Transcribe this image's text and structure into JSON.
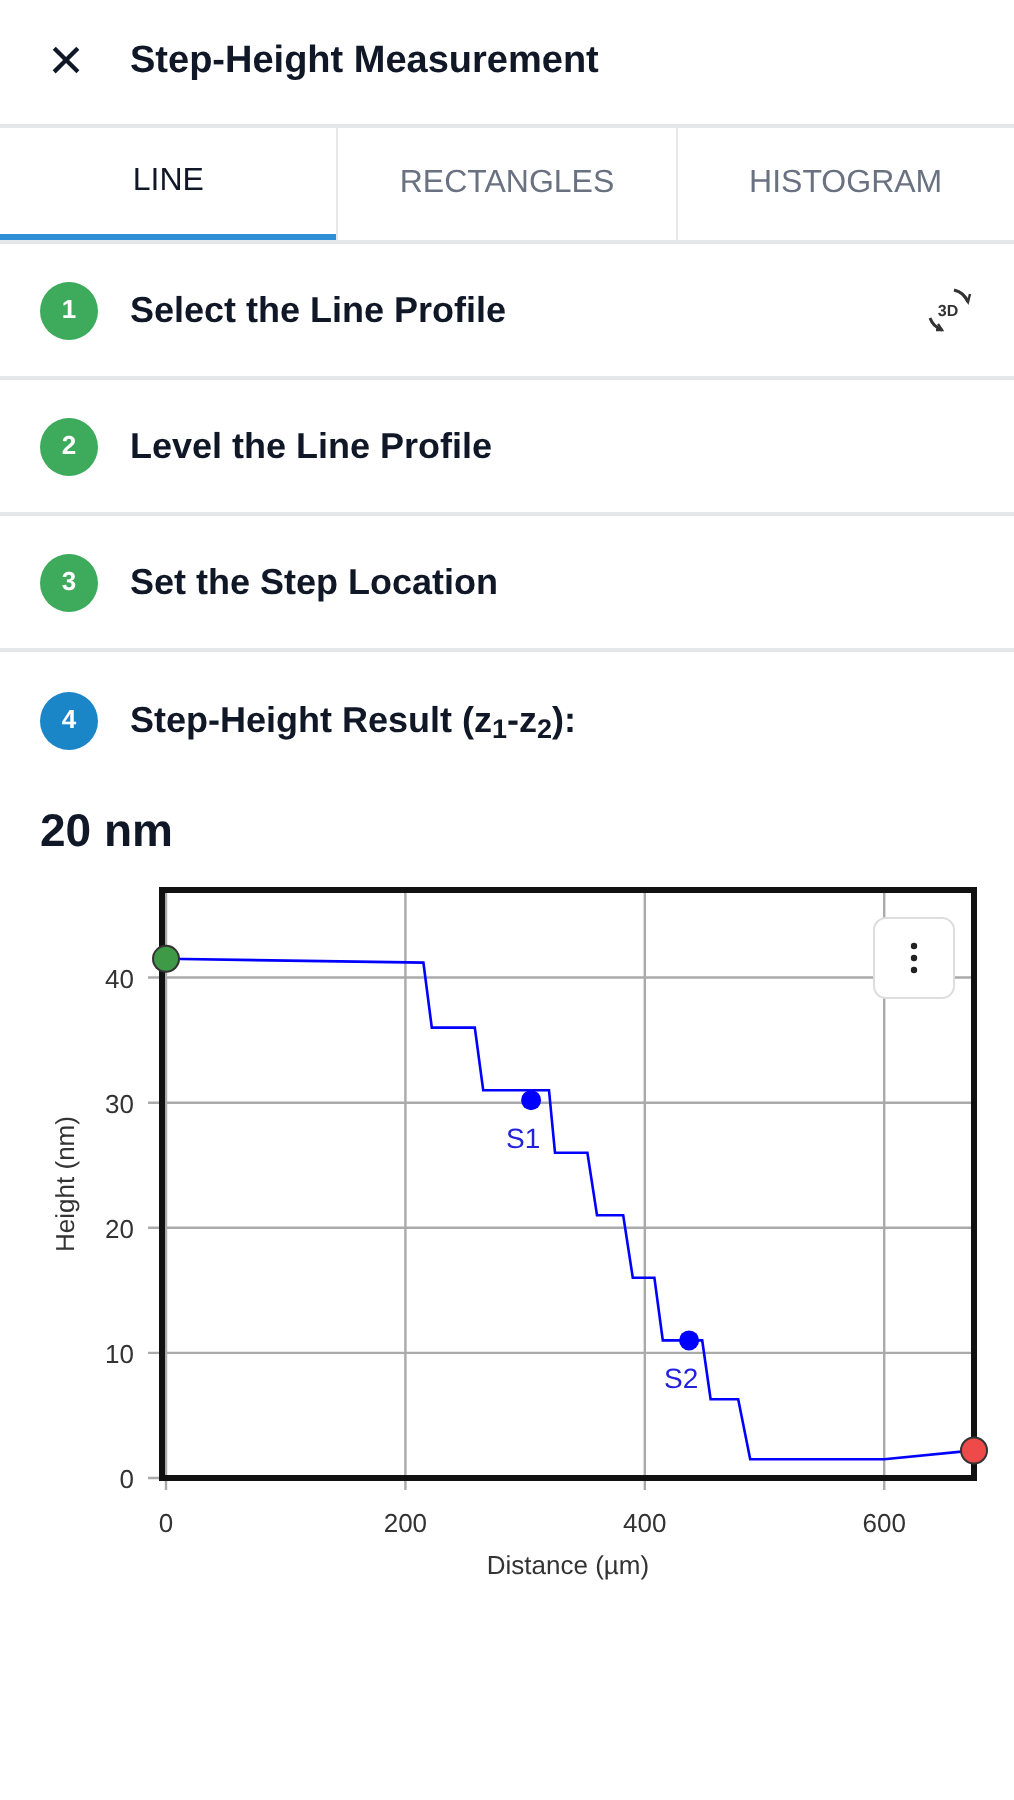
{
  "header": {
    "close": "×",
    "title": "Step-Height Measurement"
  },
  "tabs": [
    {
      "label": "LINE",
      "selected": true
    },
    {
      "label": "RECTANGLES",
      "selected": false
    },
    {
      "label": "HISTOGRAM",
      "selected": false
    }
  ],
  "steps": [
    {
      "number": "1",
      "title": "Select the Line Profile",
      "completed": true,
      "action_icon_label": "3D"
    },
    {
      "number": "2",
      "title": "Level the Line Profile",
      "completed": true
    },
    {
      "number": "3",
      "title": "Set the Step Location",
      "completed": true
    },
    {
      "number": "4",
      "title": "Step-Height Result (z$_{1}$-z$_{2}$):",
      "completed": false
    }
  ],
  "result": "20 nm",
  "chart_data": {
    "type": "line",
    "xlabel": "Distance (µm)",
    "ylabel": "Height (nm)",
    "x": [
      0,
      215,
      222,
      258,
      265,
      320,
      325,
      352,
      360,
      382,
      390,
      408,
      415,
      448,
      455,
      478,
      488,
      600,
      675
    ],
    "series": [
      {
        "color": "#0000ff",
        "values": [
          41.5,
          41.2,
          36,
          36,
          31,
          31,
          26,
          26,
          21,
          21,
          16,
          16,
          11,
          11,
          6.3,
          6.3,
          1.5,
          1.5,
          2.2
        ]
      }
    ],
    "xlim": [
      0,
      675
    ],
    "ylim": [
      0,
      47
    ],
    "xticks": [
      0,
      200,
      400,
      600
    ],
    "yticks": [
      0,
      10,
      20,
      30,
      40
    ],
    "grid": true,
    "annotations": [
      {
        "x": 305,
        "y": 30.2,
        "text": "S1"
      },
      {
        "x": 437,
        "y": 11,
        "text": "S2"
      }
    ]
  }
}
